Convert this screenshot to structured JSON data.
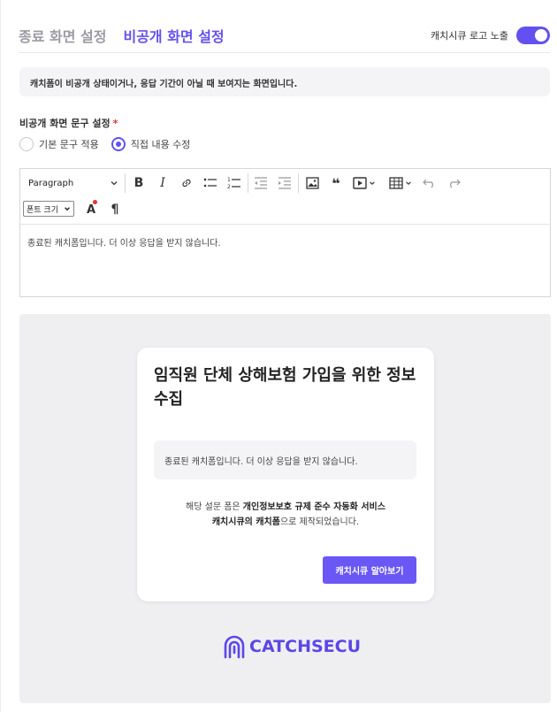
{
  "tabs": [
    {
      "label": "종료 화면 설정",
      "active": false
    },
    {
      "label": "비공개 화면 설정",
      "active": true
    }
  ],
  "logo_toggle": {
    "label": "캐치시큐 로고 노출",
    "on": true
  },
  "notice": "캐치폼이 비공개 상태이거나, 응답 기간이 아닐 때 보여지는 화면입니다.",
  "text_setting": {
    "label": "비공개 화면 문구 설정",
    "required_mark": "*",
    "options": [
      {
        "label": "기본 문구 적용",
        "checked": false
      },
      {
        "label": "직접 내용 수정",
        "checked": true
      }
    ]
  },
  "editor": {
    "paragraph_select": "Paragraph",
    "font_size_select": "폰트 크기",
    "content": "종료된 캐치폼입니다. 더 이상 응답을 받지 않습니다.",
    "toolbar_icons": [
      "bold-icon",
      "italic-icon",
      "link-icon",
      "bulleted-list-icon",
      "numbered-list-icon",
      "outdent-icon",
      "indent-icon",
      "image-icon",
      "blockquote-icon",
      "media-embed-icon",
      "table-icon",
      "undo-icon",
      "redo-icon",
      "font-color-icon",
      "paragraph-mark-icon"
    ]
  },
  "preview": {
    "title": "임직원 단체 상해보험 가입을 위한 정보 수집",
    "message": "종료된 캐치폼입니다. 더 이상 응답을 받지 않습니다.",
    "credit_prefix": "해당 설문 폼은 ",
    "credit_bold1": "개인정보보호 규제 준수 자동화 서비스",
    "credit_bold2": "캐치시큐의 캐치폼",
    "credit_suffix": "으로 제작되었습니다.",
    "button": "캐치시큐 알아보기",
    "brand": "CATCHSECU"
  },
  "colors": {
    "accent": "#6251f0",
    "required": "#e0342e",
    "preview_bg": "#efeff1"
  }
}
